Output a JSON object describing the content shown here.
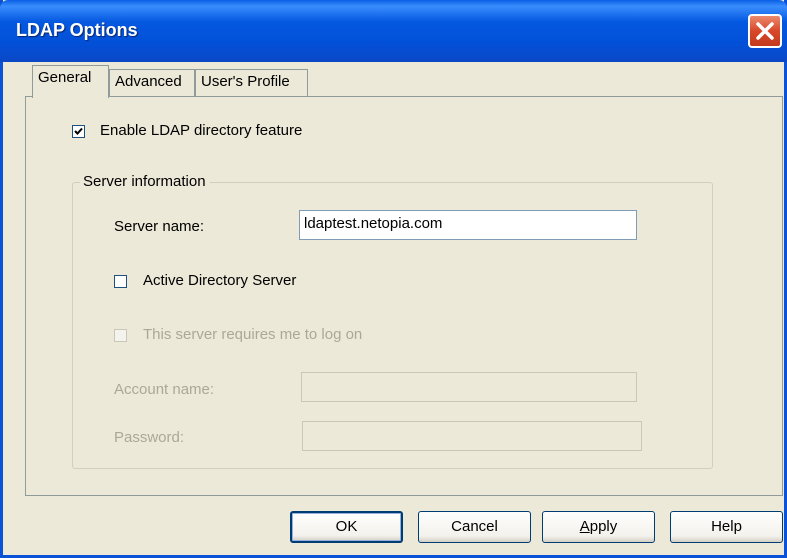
{
  "window": {
    "title": "LDAP Options"
  },
  "tabs": [
    {
      "label": "General",
      "active": true
    },
    {
      "label": "Advanced",
      "active": false
    },
    {
      "label": "User's Profile",
      "active": false
    }
  ],
  "general": {
    "enable_ldap": {
      "label": "Enable LDAP directory feature",
      "checked": true
    },
    "server_group": {
      "legend": "Server information",
      "server_name": {
        "label": "Server name:",
        "value": "ldaptest.netopia.com"
      },
      "active_directory": {
        "label": "Active Directory Server",
        "checked": false
      },
      "requires_logon": {
        "label": "This server requires me to log on",
        "checked": false,
        "enabled": false
      },
      "account_name": {
        "label": "Account name:",
        "value": "",
        "enabled": false
      },
      "password": {
        "label": "Password:",
        "value": "",
        "enabled": false
      }
    }
  },
  "buttons": {
    "ok": "OK",
    "cancel": "Cancel",
    "apply_mnemonic": "A",
    "apply_rest": "pply",
    "help": "Help"
  },
  "colors": {
    "titlebar": "#0458e0",
    "close": "#d8472a",
    "face": "#ece9d8"
  }
}
